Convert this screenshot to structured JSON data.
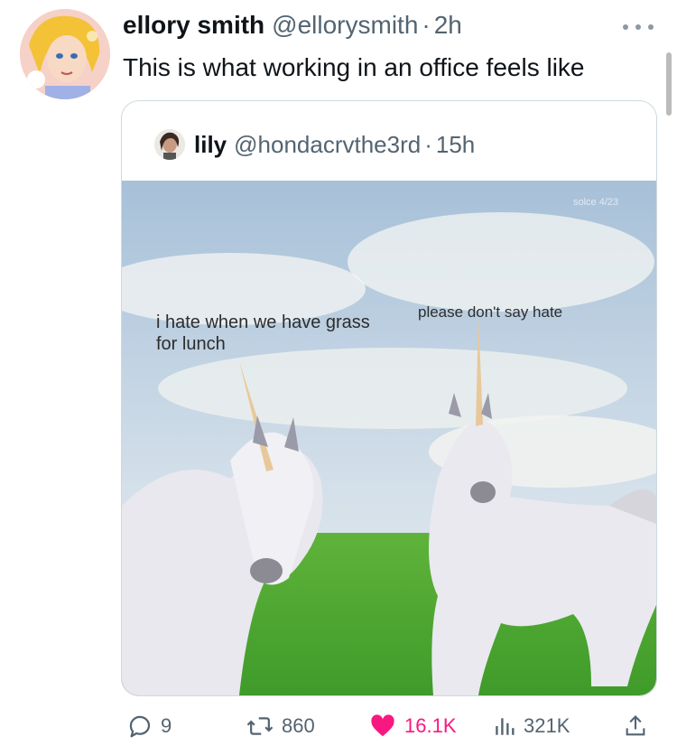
{
  "tweet": {
    "display_name": "ellory smith",
    "handle": "@ellorysmith",
    "separator": "·",
    "time": "2h",
    "text": "This is what working in an office feels like"
  },
  "quoted_tweet": {
    "display_name": "lily",
    "handle": "@hondacrvthe3rd",
    "separator": "·",
    "time": "15h",
    "media": {
      "watermark": "solce 4/23",
      "caption_left": "i hate when we have grass for lunch",
      "caption_right": "please don't say hate"
    }
  },
  "actions": {
    "replies": "9",
    "reposts": "860",
    "likes": "16.1K",
    "views": "321K"
  },
  "colors": {
    "like": "#f91880",
    "muted": "#536471",
    "border": "#cfd9de"
  },
  "icons": [
    "more-icon",
    "reply-icon",
    "repost-icon",
    "like-icon",
    "views-icon",
    "share-icon"
  ]
}
